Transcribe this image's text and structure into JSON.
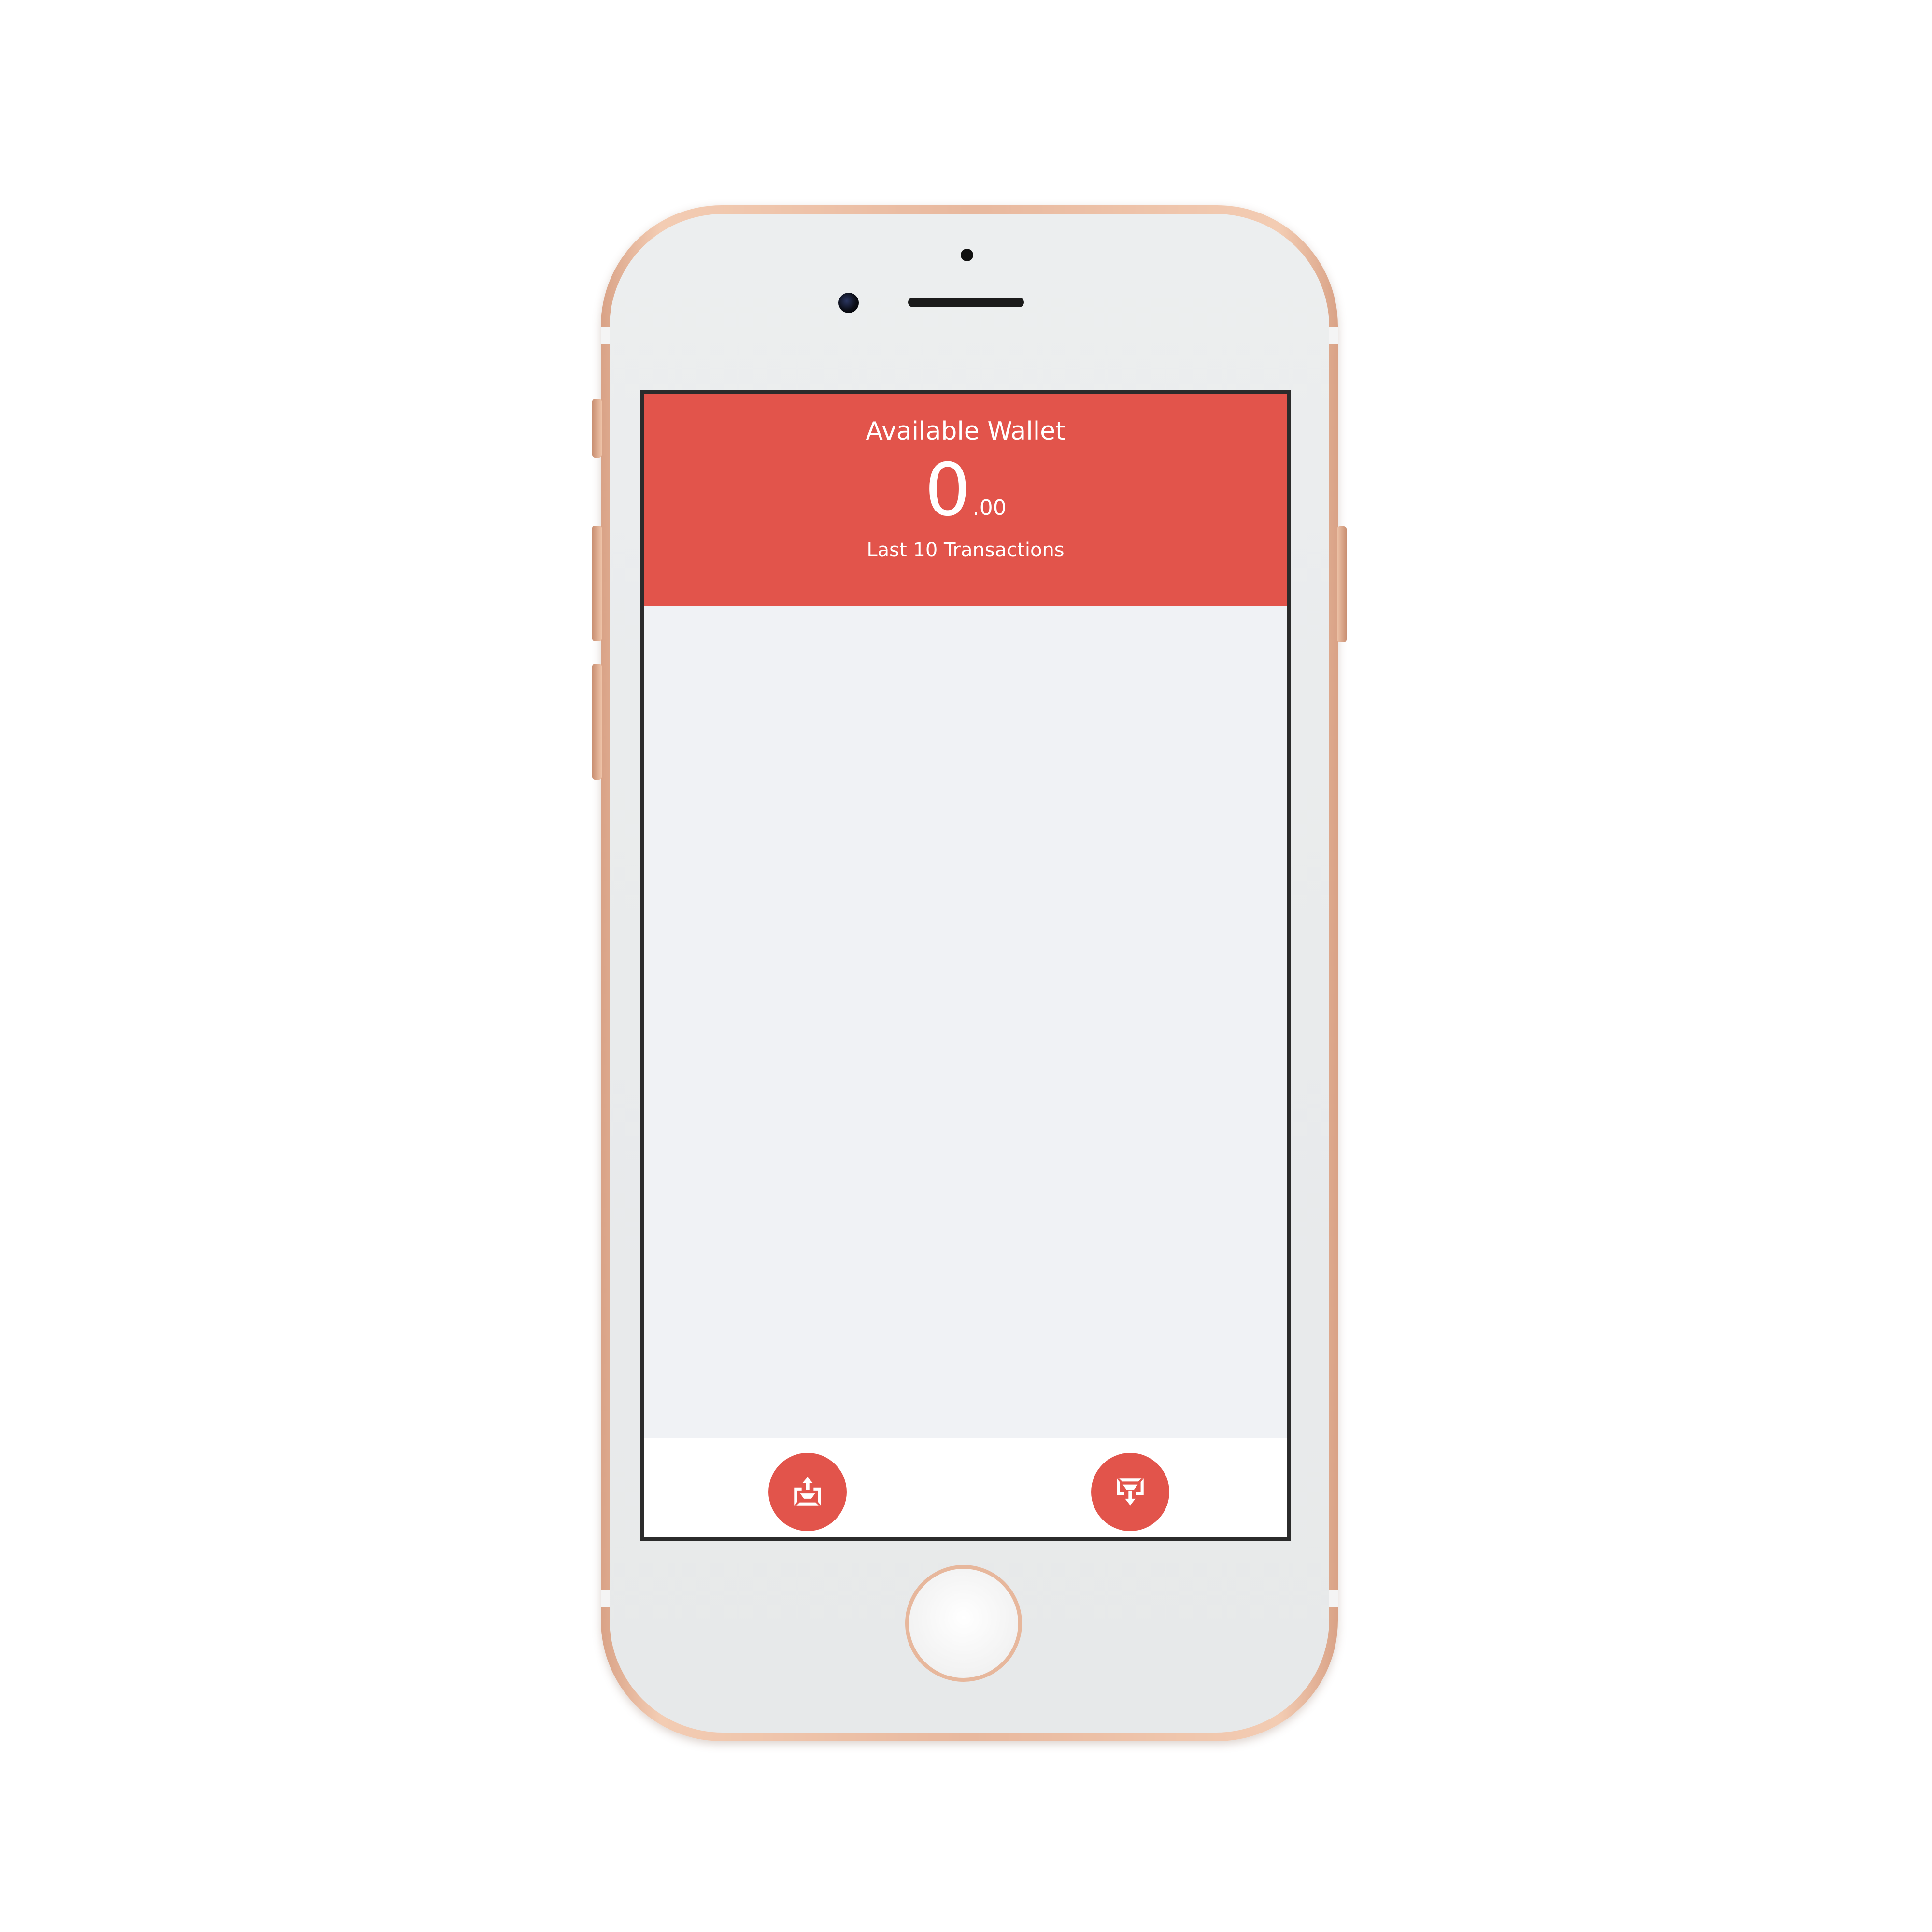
{
  "wallet": {
    "title": "Available Wallet",
    "balance_integer": "0",
    "balance_decimal": ".00",
    "transactions_label": "Last 10 Transactions"
  },
  "transactions": [],
  "bottom_bar": {
    "send_icon": "wallet-send-icon",
    "receive_icon": "wallet-receive-icon"
  },
  "colors": {
    "accent": "#e2544b",
    "screen_background": "#f0f2f5",
    "bottom_bar_background": "#ffffff",
    "phone_frame": "#e8b89e"
  }
}
